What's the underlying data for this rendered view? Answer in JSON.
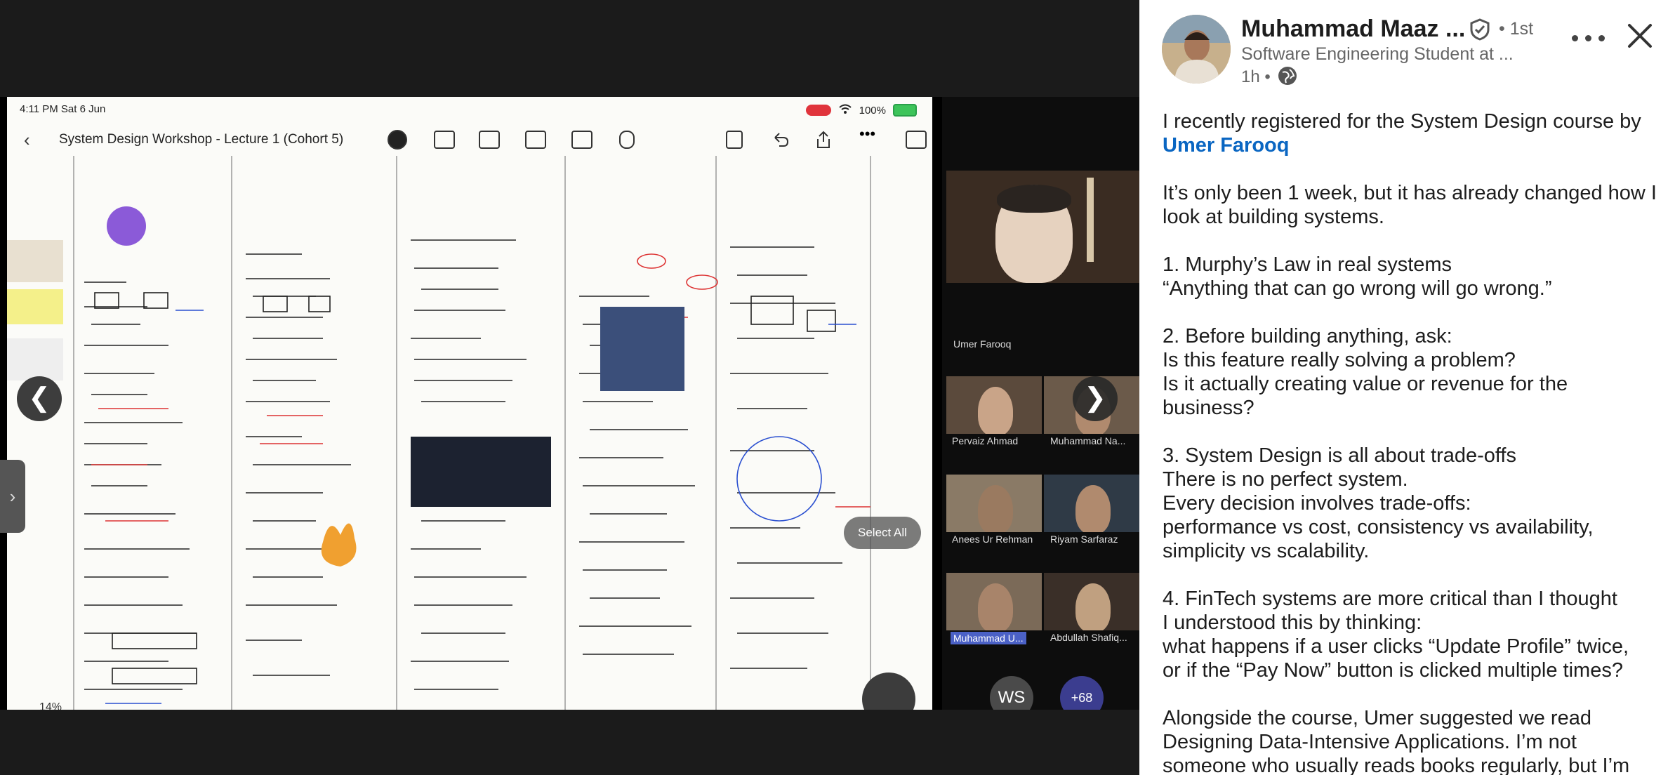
{
  "viewer": {
    "status_bar": {
      "time": "4:11 PM  Sat 6 Jun",
      "battery": "100%"
    },
    "document_title": "System Design Workshop - Lecture 1 (Cohort 5)",
    "zoom_level": "14%",
    "select_all_label": "Select All",
    "side_tab_icon": "chevron-right",
    "prev_arrow": "❮",
    "next_arrow": "❯",
    "zoom_participants": {
      "speaker": "Umer Farooq",
      "tiles": [
        {
          "name": "Pervaiz Ahmad"
        },
        {
          "name": "Muhammad Na..."
        },
        {
          "name": "Anees Ur Rehman"
        },
        {
          "name": "Riyam Sarfaraz"
        },
        {
          "name": "Muhammad U...",
          "active": true
        },
        {
          "name": "Abdullah Shafiq..."
        }
      ],
      "avatars": [
        {
          "initials": "WS",
          "color": "#4a4a4a"
        },
        {
          "initials": "+68",
          "color": "#3b3d8f"
        }
      ]
    }
  },
  "post": {
    "author": {
      "name": "Muhammad Maaz ...",
      "degree": "• 1st",
      "headline": "Software Engineering Student at ...",
      "time": "1h •"
    },
    "body": {
      "intro": "I recently registered for the System Design course by",
      "mention": "Umer Farooq",
      "p1": [
        "It’s only been 1 week, but it has already changed how I",
        "look at building systems."
      ],
      "p2": [
        "1. Murphy’s Law in real systems",
        "“Anything that can go wrong will go wrong.”"
      ],
      "p3": [
        "2. Before building anything, ask:",
        "Is this feature really solving a problem?",
        "Is it actually creating value or revenue for the",
        "business?"
      ],
      "p4": [
        "3. System Design is all about trade-offs",
        "There is no perfect system.",
        "Every decision involves trade-offs:",
        "performance vs cost, consistency vs availability,",
        "simplicity vs scalability."
      ],
      "p5": [
        "4. FinTech systems are more critical than I thought",
        "I understood this by thinking:",
        "what happens if a user clicks “Update Profile” twice,",
        "or if the “Pay Now” button is clicked multiple times?"
      ],
      "p6": [
        "Alongside the course, Umer suggested we read",
        "Designing Data-Intensive Applications. I’m not",
        "someone who usually reads books regularly, but I’m"
      ]
    }
  },
  "colors": {
    "link": "#0a66c2",
    "background_dark": "#1b1b1b",
    "panel": "#ffffff"
  }
}
